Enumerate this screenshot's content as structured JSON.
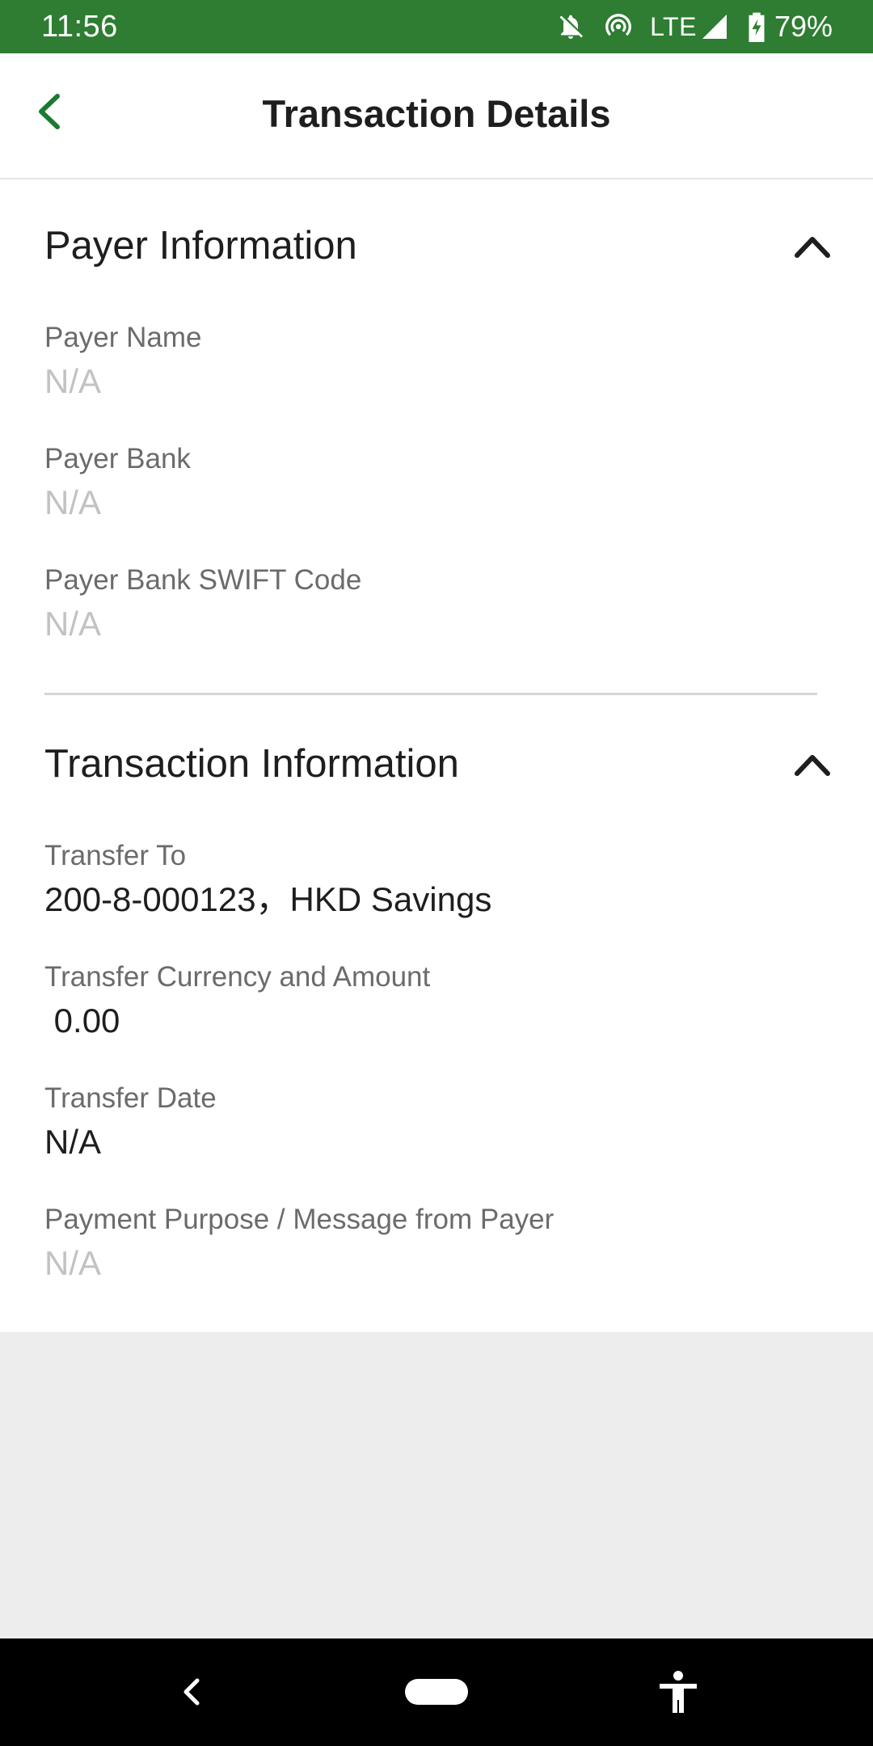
{
  "status_bar": {
    "time": "11:56",
    "network": "LTE",
    "battery": "79%",
    "icons": [
      "notifications-off-icon",
      "hotspot-icon",
      "signal-icon",
      "battery-charging-icon"
    ]
  },
  "header": {
    "title": "Transaction Details",
    "back_icon": "chevron-left-icon",
    "accent_color": "#1b7a2e"
  },
  "sections": {
    "payer": {
      "title": "Payer Information",
      "expanded": true,
      "fields": [
        {
          "label": "Payer Name",
          "value": "N/A"
        },
        {
          "label": "Payer Bank",
          "value": "N/A"
        },
        {
          "label": "Payer Bank SWIFT Code",
          "value": "N/A"
        }
      ]
    },
    "transaction": {
      "title": "Transaction Information",
      "expanded": true,
      "fields": [
        {
          "label": "Transfer To",
          "value": "200-8-000123，HKD Savings"
        },
        {
          "label": "Transfer Currency and Amount",
          "value": " 0.00"
        },
        {
          "label": "Transfer Date",
          "value": "N/A"
        },
        {
          "label": "Payment Purpose / Message from Payer",
          "value": "N/A"
        }
      ]
    }
  },
  "nav_bar": {
    "icons": [
      "back-icon",
      "home-pill-icon",
      "accessibility-icon"
    ]
  },
  "colors": {
    "status_bar": "#2e7d32",
    "page_background": "#ededed",
    "card_background": "#ffffff",
    "label_text": "#6b6b6b",
    "muted_value": "#c2c2c2",
    "dark_value": "#1e1e1e"
  }
}
